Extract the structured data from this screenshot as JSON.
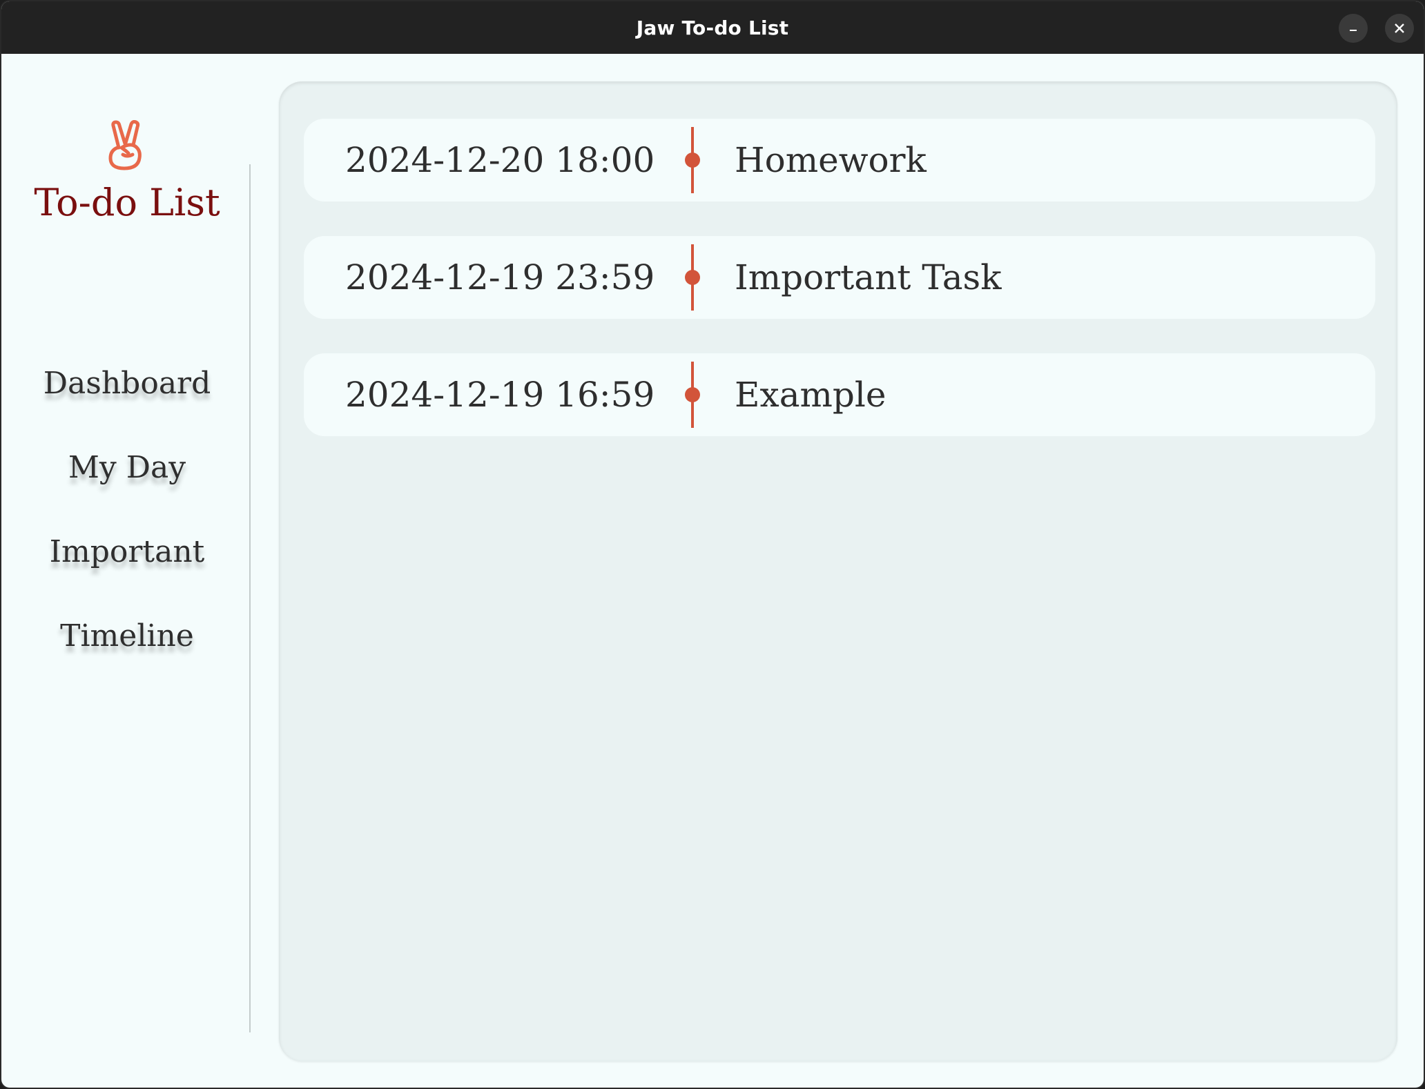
{
  "window": {
    "title": "Jaw To-do List",
    "minimize_icon": "minimize-icon",
    "close_icon": "close-icon"
  },
  "sidebar": {
    "logo_icon": "victory-hand-icon",
    "brand": "To-do List",
    "items": [
      {
        "label": "Dashboard"
      },
      {
        "label": "My Day"
      },
      {
        "label": "Important"
      },
      {
        "label": "Timeline"
      }
    ]
  },
  "timeline": {
    "tasks": [
      {
        "datetime": "2024-12-20 18:00",
        "name": "Homework"
      },
      {
        "datetime": "2024-12-19 23:59",
        "name": "Important Task"
      },
      {
        "datetime": "2024-12-19 16:59",
        "name": "Example"
      }
    ]
  },
  "colors": {
    "accent": "#d2543a",
    "brand": "#7a0f0f",
    "background": "#f4fcfc",
    "panel": "#e9f2f2"
  }
}
